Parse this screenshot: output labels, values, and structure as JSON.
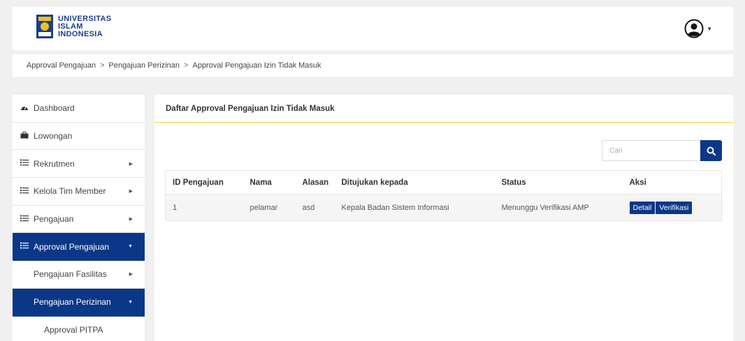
{
  "header": {
    "logo_line1": "UNIVERSITAS",
    "logo_line2": "ISLAM",
    "logo_line3": "INDONESIA",
    "user_icon": "user-circle-icon"
  },
  "breadcrumb": {
    "items": [
      "Approval Pengajuan",
      "Pengajuan Perizinan",
      "Approval Pengajuan Izin Tidak Masuk"
    ],
    "separator": ">"
  },
  "sidebar": {
    "items": [
      {
        "label": "Dashboard",
        "icon": "dashboard-icon"
      },
      {
        "label": "Lowongan",
        "icon": "briefcase-icon"
      },
      {
        "label": "Rekrutmen",
        "icon": "list-icon"
      },
      {
        "label": "Kelola Tim Member",
        "icon": "list-icon"
      },
      {
        "label": "Pengajuan",
        "icon": "list-icon"
      },
      {
        "label": "Approval Pengajuan",
        "icon": "list-icon"
      },
      {
        "label": "Pengajuan Fasilitas"
      },
      {
        "label": "Pengajuan Perizinan"
      },
      {
        "label": "Approval PITPA"
      }
    ]
  },
  "main": {
    "panel_title": "Daftar Approval Pengajuan Izin Tidak Masuk",
    "search_placeholder": "Cari",
    "columns": [
      "ID Pengajuan",
      "Nama",
      "Alasan",
      "Ditujukan kepada",
      "Status",
      "Aksi"
    ],
    "rows": [
      {
        "id": "1",
        "nama": "pelamar",
        "alasan": "asd",
        "ditujukan": "Kepala Badan Sistem Informasi",
        "status": "Menunggu Verifikasi AMP",
        "detail_label": "Detail",
        "verifikasi_label": "Verifikasi"
      }
    ]
  },
  "colors": {
    "primary": "#0b3788",
    "accent_line": "#f2d13c",
    "background": "#f0f0f0"
  }
}
